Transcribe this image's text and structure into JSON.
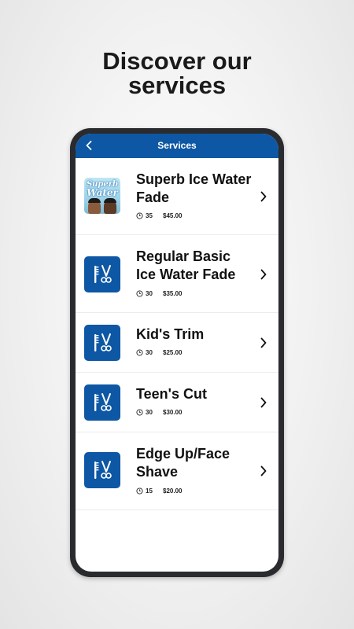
{
  "headline": {
    "line1": "Discover our",
    "line2": "services"
  },
  "appbar": {
    "title": "Services",
    "back_icon": "chevron-left-icon"
  },
  "colors": {
    "brand": "#0d57a4",
    "phone_frame": "#2a2b2e",
    "text": "#111111"
  },
  "services": [
    {
      "name": "Superb Ice Water Fade",
      "duration": "35",
      "price": "$45.00",
      "thumbnail": "photo",
      "photo_text": [
        "Superb",
        "Water"
      ]
    },
    {
      "name": "Regular Basic Ice Water Fade",
      "duration": "30",
      "price": "$35.00",
      "thumbnail": "comb-scissors-icon"
    },
    {
      "name": "Kid's Trim",
      "duration": "30",
      "price": "$25.00",
      "thumbnail": "comb-scissors-icon"
    },
    {
      "name": "Teen's Cut",
      "duration": "30",
      "price": "$30.00",
      "thumbnail": "comb-scissors-icon"
    },
    {
      "name": "Edge Up/Face Shave",
      "duration": "15",
      "price": "$20.00",
      "thumbnail": "comb-scissors-icon"
    }
  ]
}
